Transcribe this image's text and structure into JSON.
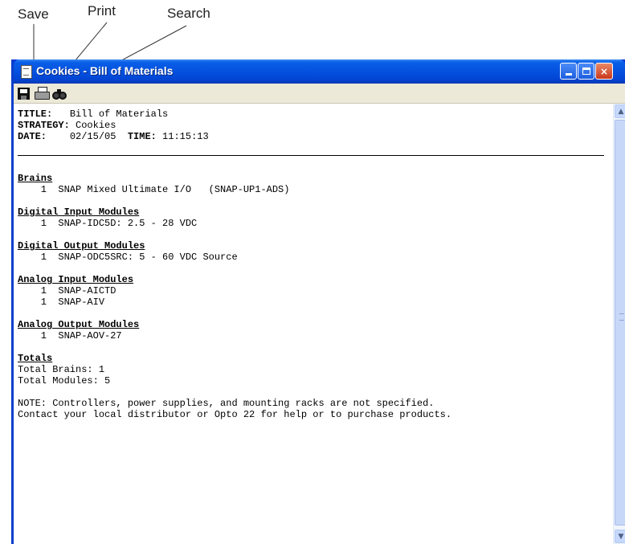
{
  "callouts": {
    "save": "Save",
    "print": "Print",
    "search": "Search"
  },
  "window": {
    "title": "Cookies - Bill of Materials",
    "controls": {
      "minimize": "minimize",
      "maximize": "maximize",
      "close": "×"
    }
  },
  "toolbar": {
    "items": [
      {
        "name": "Save",
        "icon": "floppy-disk-icon"
      },
      {
        "name": "Print",
        "icon": "printer-icon"
      },
      {
        "name": "Search",
        "icon": "binoculars-icon"
      }
    ]
  },
  "report": {
    "header": {
      "title_label": "TITLE:",
      "title_value": "   Bill of Materials",
      "strategy_label": "STRATEGY:",
      "strategy_value": " Cookies",
      "date_label": "DATE:",
      "date_value": "    02/15/05  ",
      "time_label": "TIME:",
      "time_value": " 11:15:13"
    },
    "sections": [
      {
        "heading": "Brains",
        "items": [
          "    1  SNAP Mixed Ultimate I/O   (SNAP-UP1-ADS)"
        ]
      },
      {
        "heading": "Digital Input Modules",
        "items": [
          "    1  SNAP-IDC5D: 2.5 - 28 VDC"
        ]
      },
      {
        "heading": "Digital Output Modules",
        "items": [
          "    1  SNAP-ODC5SRC: 5 - 60 VDC Source"
        ]
      },
      {
        "heading": "Analog Input Modules",
        "items": [
          "    1  SNAP-AICTD",
          "    1  SNAP-AIV"
        ]
      },
      {
        "heading": "Analog Output Modules",
        "items": [
          "    1  SNAP-AOV-27"
        ]
      }
    ],
    "totals": {
      "heading": "Totals",
      "brains": "Total Brains: 1",
      "modules": "Total Modules: 5"
    },
    "note": [
      "NOTE: Controllers, power supplies, and mounting racks are not specified.",
      "Contact your local distributor or Opto 22 for help or to purchase products."
    ]
  },
  "colors": {
    "titlebar": "#0553e0",
    "toolbar": "#ece9d8",
    "close": "#c9381a"
  }
}
